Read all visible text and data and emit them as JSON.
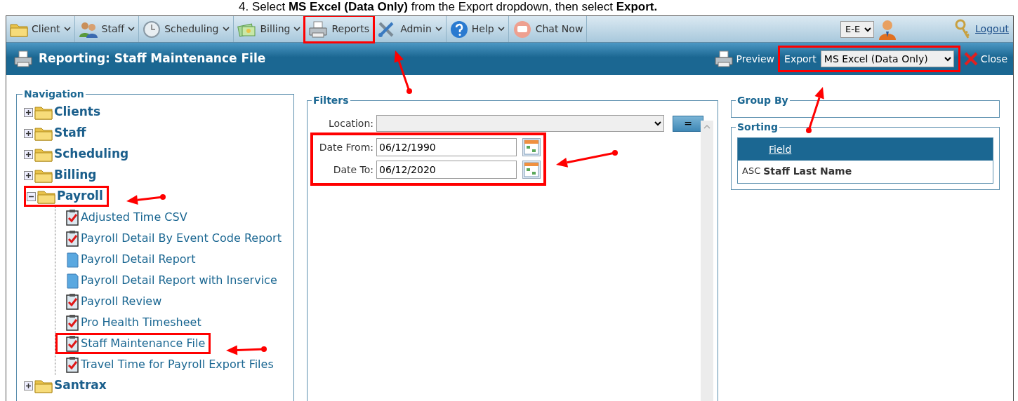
{
  "instruction": "4. Select **MS Excel (Data Only)** from the Export dropdown, then select **Export.**",
  "menu": [
    {
      "label": "Client",
      "dropdown": true,
      "highlighted": false
    },
    {
      "label": "Staff",
      "dropdown": true,
      "highlighted": false
    },
    {
      "label": "Scheduling",
      "dropdown": true,
      "highlighted": false
    },
    {
      "label": "Billing",
      "dropdown": true,
      "highlighted": false
    },
    {
      "label": "Reports",
      "dropdown": false,
      "highlighted": true
    },
    {
      "label": "Admin",
      "dropdown": true,
      "highlighted": false
    },
    {
      "label": "Help",
      "dropdown": true,
      "highlighted": false
    },
    {
      "label": "Chat Now",
      "dropdown": false,
      "highlighted": false
    }
  ],
  "user_bar": {
    "language": "E-E",
    "logout": "Logout"
  },
  "title_bar": {
    "title": "Reporting: Staff Maintenance File",
    "preview": "Preview",
    "export_label": "Export",
    "export_value": "MS Excel (Data Only)",
    "export_highlighted": true,
    "close": "Close"
  },
  "navigation": {
    "legend": "Navigation",
    "items": [
      {
        "label": "Clients",
        "expanded": false,
        "highlighted": false
      },
      {
        "label": "Staff",
        "expanded": false,
        "highlighted": false
      },
      {
        "label": "Scheduling",
        "expanded": false,
        "highlighted": false
      },
      {
        "label": "Billing",
        "expanded": false,
        "highlighted": false
      },
      {
        "label": "Payroll",
        "expanded": true,
        "highlighted": true,
        "children": [
          {
            "label": "Adjusted Time CSV",
            "kind": "checklist",
            "highlighted": false
          },
          {
            "label": "Payroll Detail By Event Code Report",
            "kind": "checklist",
            "highlighted": false
          },
          {
            "label": "Payroll Detail Report",
            "kind": "document",
            "highlighted": false
          },
          {
            "label": "Payroll Detail Report with Inservice",
            "kind": "document",
            "highlighted": false
          },
          {
            "label": "Payroll Review",
            "kind": "checklist",
            "highlighted": false
          },
          {
            "label": "Pro Health Timesheet",
            "kind": "checklist",
            "highlighted": false
          },
          {
            "label": "Staff Maintenance File",
            "kind": "checklist",
            "highlighted": true
          },
          {
            "label": "Travel Time for Payroll Export Files",
            "kind": "checklist",
            "highlighted": false
          }
        ]
      },
      {
        "label": "Santrax",
        "expanded": false,
        "highlighted": false
      }
    ]
  },
  "filters": {
    "legend": "Filters",
    "location_label": "Location:",
    "location_button": "=",
    "dates_highlighted": true,
    "dates": [
      {
        "label": "Date From:",
        "value": "06/12/1990"
      },
      {
        "label": "Date To:",
        "value": "06/12/2020"
      }
    ]
  },
  "group_by": {
    "legend": "Group By"
  },
  "sorting": {
    "legend": "Sorting",
    "column": "Field",
    "rows": [
      {
        "order": "ASC",
        "field": "Staff Last Name"
      }
    ]
  }
}
